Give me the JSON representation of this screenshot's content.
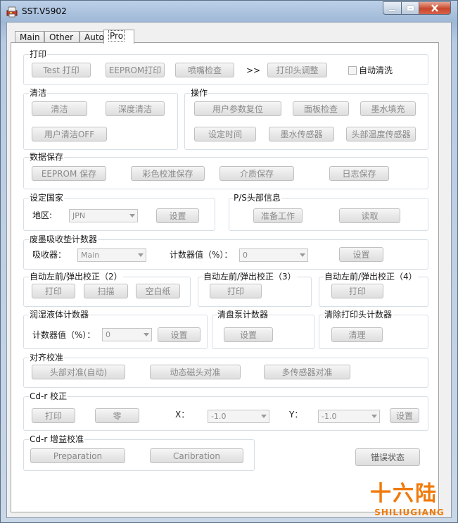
{
  "window": {
    "title": "SST.V5902"
  },
  "tabs": [
    "Main",
    "Other",
    "Auto",
    "Pro"
  ],
  "print": {
    "label": "打印",
    "test_print": "Test 打印",
    "eeprom_print": "EEPROM打印",
    "nozzle_check": "喷嘴检查",
    "arrows": ">>",
    "head_adjust": "打印头调整",
    "auto_clean": "自动清洗"
  },
  "clean": {
    "label": "清洁",
    "clean": "清洁",
    "deep_clean": "深度清洁",
    "user_clean_off": "用户清洁OFF"
  },
  "operation": {
    "label": "操作",
    "param_reset": "用户参数复位",
    "panel_check": "面板检查",
    "ink_fill": "墨水填充",
    "set_time": "设定时间",
    "ink_sensor": "墨水传感器",
    "head_temp_sensor": "头部温度传感器"
  },
  "data_save": {
    "label": "数据保存",
    "eeprom_save": "EEPROM 保存",
    "color_save": "彩色校准保存",
    "media_save": "介质保存",
    "log_save": "日志保存"
  },
  "country": {
    "label": "设定国家",
    "region_label": "地区:",
    "region_value": "JPN",
    "set": "设置"
  },
  "ps_head": {
    "label": "P/S头部信息",
    "prepare": "准备工作",
    "read": "读取"
  },
  "waste_counter": {
    "label": "废墨吸收垫计数器",
    "absorber_label": "吸收器：",
    "absorber_value": "Main",
    "counter_label": "计数器值（%）：",
    "counter_value": "0",
    "set": "设置"
  },
  "auto_align2": {
    "label": "自动左前/弹出校正（2）",
    "print": "打印",
    "scan": "扫描",
    "blank": "空白纸"
  },
  "auto_align3": {
    "label": "自动左前/弹出校正（3）",
    "print": "打印"
  },
  "auto_align4": {
    "label": "自动左前/弹出校正（4）",
    "print": "打印"
  },
  "wet_counter": {
    "label": "润湿液体计数器",
    "counter_label": "计数器值（%）：",
    "counter_value": "0",
    "set": "设置"
  },
  "pump_counter": {
    "label": "清盘泵计数器",
    "set": "设置"
  },
  "clear_head": {
    "label": "清除打印头计数器",
    "clear": "清理"
  },
  "alignment": {
    "label": "对齐校准",
    "head_auto": "头部对准(自动)",
    "dynamic": "动态磁头对准",
    "multi_sensor": "多传感器对准"
  },
  "cdr": {
    "label": "Cd-r 校正",
    "print": "打印",
    "zero": "零",
    "x_label": "X：",
    "x_value": "-1.0",
    "y_label": "Y：",
    "y_value": "-1.0",
    "set": "设置"
  },
  "cdr_gain": {
    "label": "Cd-r 增益校准",
    "preparation": "Preparation",
    "calibration": "Caribration"
  },
  "error_status": "错误状态",
  "watermark": {
    "big": "十六陆",
    "small": "SHILIUGIANG"
  }
}
